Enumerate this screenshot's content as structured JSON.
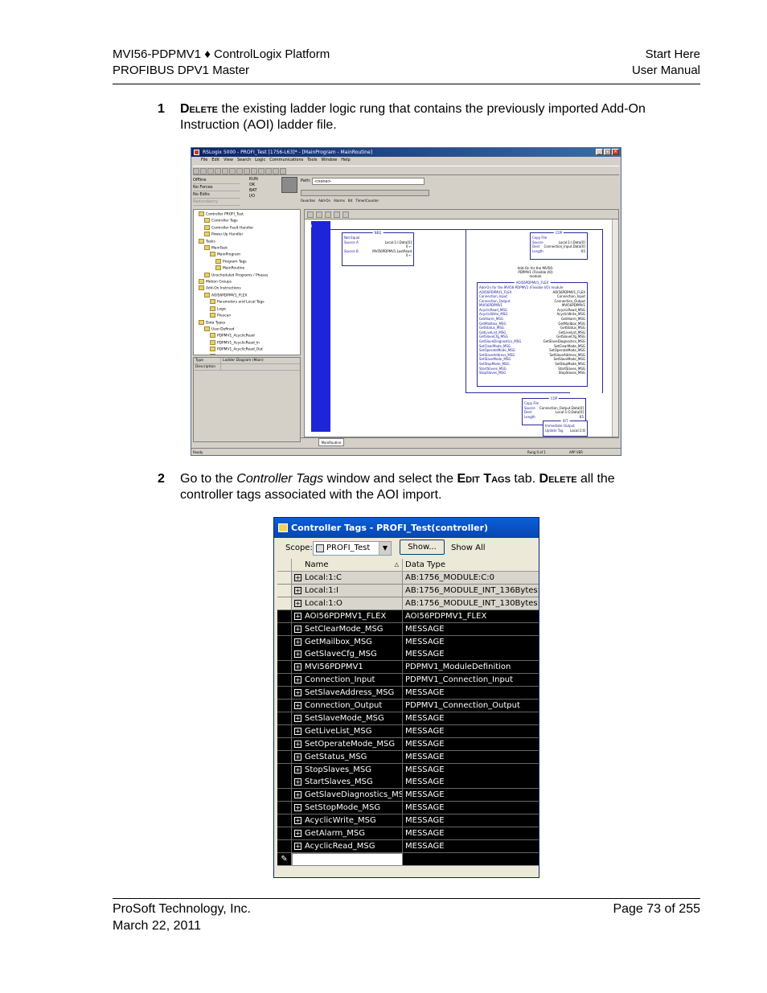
{
  "header": {
    "left_line1": "MVI56-PDPMV1 ♦ ControlLogix Platform",
    "left_line2": "PROFIBUS DPV1 Master",
    "right_line1": "Start Here",
    "right_line2": "User Manual"
  },
  "steps": [
    {
      "number": "1",
      "keyword": "Delete",
      "text": " the existing ladder logic rung that contains the previously imported Add-On Instruction (AOI) ladder file."
    },
    {
      "number": "2",
      "text_a": "Go to the ",
      "italic": "Controller Tags",
      "text_b": " window and select the ",
      "keyword_a": "Edit Tags",
      "text_c": " tab. ",
      "keyword_b": "Delete",
      "text_d": " all the controller tags associated with the AOI import."
    }
  ],
  "rslogix": {
    "title": "RSLogix 5000 - PROFI_Test [1756-L63]* - [MainProgram - MainRoutine]",
    "menu": [
      "File",
      "Edit",
      "View",
      "Search",
      "Logic",
      "Communications",
      "Tools",
      "Window",
      "Help"
    ],
    "status": [
      "Offline",
      "No Forces",
      "No Edits",
      "Redundancy"
    ],
    "leds": [
      "RUN",
      "OK",
      "BAT",
      "I/O"
    ],
    "path_label": "Path:",
    "path_value": "<none>",
    "tabs": [
      "Favorites",
      "Add-On",
      "Alarms",
      "Bit",
      "Timer/Counter"
    ],
    "organizer": [
      "Controller PROFI_Test",
      "Controller Tags",
      "Controller Fault Handler",
      "Power-Up Handler",
      "Tasks",
      "MainTask",
      "MainProgram",
      "Program Tags",
      "MainRoutine",
      "Unscheduled Programs / Phases",
      "Motion Groups",
      "Add-On Instructions",
      "AOI56PDPMV1_FLEX",
      "Parameters and Local Tags",
      "Logic",
      "Prescan",
      "Data Types",
      "User-Defined",
      "PDPMV1_AcyclicRead",
      "PDPMV1_AcyclicRead_In",
      "PDPMV1_AcyclicRead_Out",
      "PDPMV1_AcyclicWrite",
      "PDPMV1_AcyclicWrite_In",
      "PDPMV1_AcyclicWrite_Out",
      "PDPMV1_Alarm",
      "PDPMV1_Backplane"
    ],
    "props": [
      {
        "k": "Type",
        "v": "Ladder Diagram (Main)"
      },
      {
        "k": "Description",
        "v": ""
      }
    ],
    "rung_number": "0",
    "neq": {
      "header": "NEQ",
      "rows": [
        {
          "a": "Not Equal",
          "b": ""
        },
        {
          "a": "Source A",
          "b": "Local:1:I.Data[0]"
        },
        {
          "a": "",
          "b": "0 ←"
        },
        {
          "a": "Source B",
          "b": "MVI56PDPMV1.LastRead"
        },
        {
          "a": "",
          "b": "0 ←"
        }
      ]
    },
    "cop1": {
      "header": "COP",
      "rows": [
        {
          "a": "Copy File",
          "b": ""
        },
        {
          "a": "Source",
          "b": "Local:1:I.Data[0]"
        },
        {
          "a": "Dest",
          "b": "Connection_Input.Data[0]"
        },
        {
          "a": "Length",
          "b": "65"
        }
      ]
    },
    "aoi_caption": "Add-On for the MVI56-PDPMV1 (Flexible I/O) module",
    "aoi": {
      "header": "AOI56PDPMV1_FLEX",
      "title": "Add-On for the MVI56-PDPMV1 (Flexible I/O) module",
      "rows": [
        {
          "a": "AOI56PDPMV1_FLEX",
          "b": "AOI56PDPMV1_FLEX"
        },
        {
          "a": "Connection_Input",
          "b": "Connection_Input"
        },
        {
          "a": "Connection_Output",
          "b": "Connection_Output"
        },
        {
          "a": "MVI56PDPMV1",
          "b": "MVI56PDPMV1"
        },
        {
          "a": "AcyclicRead_MSG",
          "b": "AcyclicRead_MSG"
        },
        {
          "a": "AcyclicWrite_MSG",
          "b": "AcyclicWrite_MSG"
        },
        {
          "a": "GetAlarm_MSG",
          "b": "GetAlarm_MSG"
        },
        {
          "a": "GetMailbox_MSG",
          "b": "GetMailbox_MSG"
        },
        {
          "a": "GetStatus_MSG",
          "b": "GetStatus_MSG"
        },
        {
          "a": "GetLiveList_MSG",
          "b": "GetLiveList_MSG"
        },
        {
          "a": "GetSlaveCfg_MSG",
          "b": "GetSlaveCfg_MSG"
        },
        {
          "a": "GetSlaveDiagnostics_MSG",
          "b": "GetSlaveDiagnostics_MSG"
        },
        {
          "a": "SetClearMode_MSG",
          "b": "SetClearMode_MSG"
        },
        {
          "a": "SetOperateMode_MSG",
          "b": "SetOperateMode_MSG"
        },
        {
          "a": "SetSlaveAddress_MSG",
          "b": "SetSlaveAddress_MSG"
        },
        {
          "a": "SetSlaveMode_MSG",
          "b": "SetSlaveMode_MSG"
        },
        {
          "a": "SetStopMode_MSG",
          "b": "SetStopMode_MSG"
        },
        {
          "a": "StartSlaves_MSG",
          "b": "StartSlaves_MSG"
        },
        {
          "a": "StopSlaves_MSG",
          "b": "StopSlaves_MSG"
        }
      ]
    },
    "cop2": {
      "header": "COP",
      "rows": [
        {
          "a": "Copy File",
          "b": ""
        },
        {
          "a": "Source",
          "b": "Connection_Output.Data[0]"
        },
        {
          "a": "Dest",
          "b": "Local:1:O.Data[0]"
        },
        {
          "a": "Length",
          "b": "65"
        }
      ]
    },
    "iot": {
      "header": "IOT",
      "rows": [
        {
          "a": "Immediate Output",
          "b": ""
        },
        {
          "a": "Update Tag",
          "b": "Local:1:O"
        }
      ]
    },
    "routine_tab": "MainRoutine",
    "statusbar_left": "Ready",
    "statusbar_mid": "Rung 0 of 1",
    "statusbar_right": "APP VER"
  },
  "tags_window": {
    "title": "Controller Tags - PROFI_Test(controller)",
    "scope_label": "Scope:",
    "scope_value": "PROFI_Test",
    "show_button": "Show...",
    "show_all": "Show All",
    "col_name": "Name",
    "col_type": "Data Type",
    "sort_glyph": "△",
    "rows": [
      {
        "name": "Local:1:C",
        "type": "AB:1756_MODULE:C:0",
        "style": "light"
      },
      {
        "name": "Local:1:I",
        "type": "AB:1756_MODULE_INT_136Bytes:I:0",
        "style": "light"
      },
      {
        "name": "Local:1:O",
        "type": "AB:1756_MODULE_INT_130Bytes:O:0",
        "style": "light"
      },
      {
        "name": "AOI56PDPMV1_FLEX",
        "type": "AOI56PDPMV1_FLEX",
        "style": "dark"
      },
      {
        "name": "SetClearMode_MSG",
        "type": "MESSAGE",
        "style": "dark"
      },
      {
        "name": "GetMailbox_MSG",
        "type": "MESSAGE",
        "style": "dark"
      },
      {
        "name": "GetSlaveCfg_MSG",
        "type": "MESSAGE",
        "style": "dark"
      },
      {
        "name": "MVI56PDPMV1",
        "type": "PDPMV1_ModuleDefinition",
        "style": "dark"
      },
      {
        "name": "Connection_Input",
        "type": "PDPMV1_Connection_Input",
        "style": "dark"
      },
      {
        "name": "SetSlaveAddress_MSG",
        "type": "MESSAGE",
        "style": "dark"
      },
      {
        "name": "Connection_Output",
        "type": "PDPMV1_Connection_Output",
        "style": "dark"
      },
      {
        "name": "SetSlaveMode_MSG",
        "type": "MESSAGE",
        "style": "dark"
      },
      {
        "name": "GetLiveList_MSG",
        "type": "MESSAGE",
        "style": "dark"
      },
      {
        "name": "SetOperateMode_MSG",
        "type": "MESSAGE",
        "style": "dark"
      },
      {
        "name": "GetStatus_MSG",
        "type": "MESSAGE",
        "style": "dark"
      },
      {
        "name": "StopSlaves_MSG",
        "type": "MESSAGE",
        "style": "dark"
      },
      {
        "name": "StartSlaves_MSG",
        "type": "MESSAGE",
        "style": "dark"
      },
      {
        "name": "GetSlaveDiagnostics_MSG",
        "type": "MESSAGE",
        "style": "dark"
      },
      {
        "name": "SetStopMode_MSG",
        "type": "MESSAGE",
        "style": "dark"
      },
      {
        "name": "AcyclicWrite_MSG",
        "type": "MESSAGE",
        "style": "dark"
      },
      {
        "name": "GetAlarm_MSG",
        "type": "MESSAGE",
        "style": "dark"
      },
      {
        "name": "AcyclicRead_MSG",
        "type": "MESSAGE",
        "style": "dark"
      }
    ],
    "new_row_glyph": "✎"
  },
  "footer": {
    "left_line1": "ProSoft Technology, Inc.",
    "left_line2": "March 22, 2011",
    "right_line1": "Page 73 of 255"
  }
}
